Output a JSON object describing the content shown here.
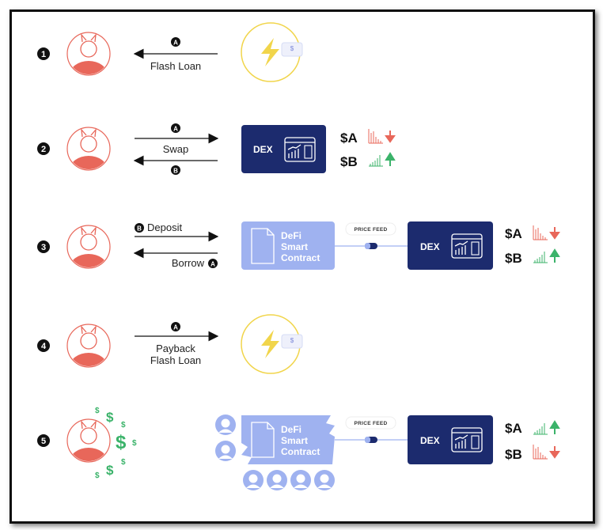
{
  "steps": [
    {
      "number": "1",
      "token": "A",
      "label": "Flash Loan"
    },
    {
      "number": "2",
      "token_top": "A",
      "token_bottom": "B",
      "label": "Swap"
    },
    {
      "number": "3",
      "deposit_token": "B",
      "deposit_label": "Deposit",
      "borrow_label": "Borrow",
      "borrow_token": "A"
    },
    {
      "number": "4",
      "token": "A",
      "label_line1": "Payback",
      "label_line2": "Flash Loan"
    },
    {
      "number": "5"
    }
  ],
  "dex_label": "DEX",
  "defi_contract": {
    "line1": "DeFi",
    "line2": "Smart",
    "line3": "Contract"
  },
  "price_feed_label": "PRICE FEED",
  "dollar_sign": "$",
  "tickers": {
    "a": "$A",
    "b": "$B"
  },
  "colors": {
    "navy": "#1c2b6e",
    "defi": "#9fb2f0",
    "red": "#e8675a",
    "green": "#3bb36a",
    "yellow": "#f1d54b"
  }
}
